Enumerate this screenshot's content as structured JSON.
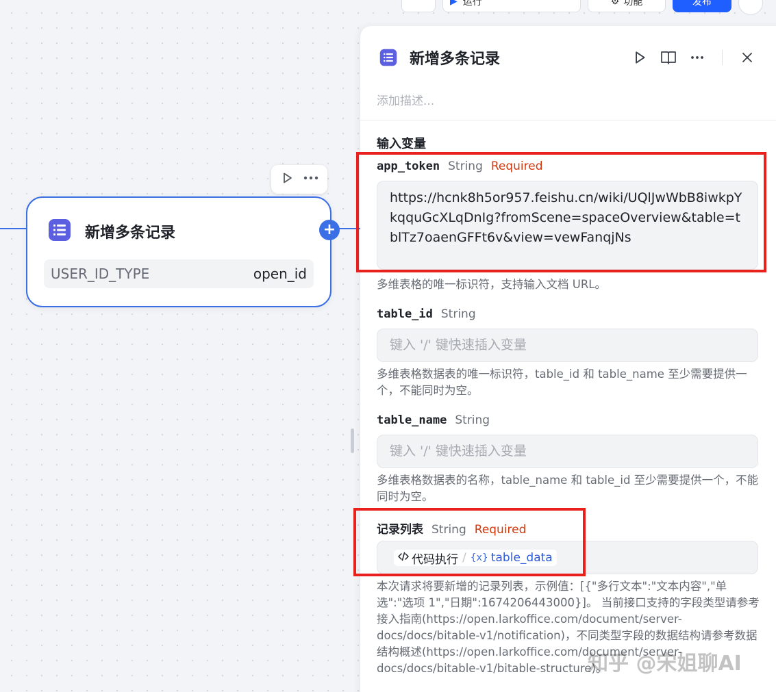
{
  "toolbar": {
    "run_label": "运行",
    "function_label": "功能",
    "publish_label": "发布"
  },
  "node": {
    "title": "新增多条记录",
    "param_key": "USER_ID_TYPE",
    "param_value": "open_id"
  },
  "panel": {
    "title": "新增多条记录",
    "description_placeholder": "添加描述...",
    "section_title": "输入变量",
    "fields": [
      {
        "name": "app_token",
        "type": "String",
        "required": "Required",
        "value": "https://hcnk8h5or957.feishu.cn/wiki/UQlJwWbB8iwkpYkqquGcXLqDnIg?fromScene=spaceOverview&table=tblTz7oaenGFFt6v&view=vewFanqjNs",
        "hint": "多维表格的唯一标识符，支持输入文档 URL。"
      },
      {
        "name": "table_id",
        "type": "String",
        "placeholder": "键入 '/' 键快速插入变量",
        "hint": "多维表格数据表的唯一标识符，table_id 和 table_name 至少需要提供一个，不能同时为空。"
      },
      {
        "name": "table_name",
        "type": "String",
        "placeholder": "键入 '/' 键快速插入变量",
        "hint": "多维表格数据表的名称，table_name 和 table_id 至少需要提供一个，不能同时为空。"
      },
      {
        "name": "记录列表",
        "type": "String",
        "required": "Required",
        "ref_node": "代码执行",
        "ref_sep": "/",
        "ref_var_icon": "{x}",
        "ref_var": "table_data",
        "hint": "本次请求将要新增的记录列表，示例值：[{\"多行文本\":\"文本内容\",\"单选\":\"选项 1\",\"日期\":1674206443000}]。 当前接口支持的字段类型请参考接入指南(https://open.larkoffice.com/document/server-docs/docs/bitable-v1/notification)，不同类型字段的数据结构请参考数据结构概述(https://open.larkoffice.com/document/server-docs/docs/bitable-v1/bitable-structure)。"
      }
    ]
  },
  "watermark": "知乎 @宋姐聊AI",
  "colors": {
    "accent": "#3b6fe6",
    "required": "#d4380d",
    "annotation": "#e8211d",
    "node_icon": "#5b5fe0"
  },
  "icons": [
    "play-icon",
    "more-icon",
    "book-icon",
    "close-icon",
    "doc-list-icon",
    "plus-icon",
    "code-icon",
    "variable-icon"
  ]
}
